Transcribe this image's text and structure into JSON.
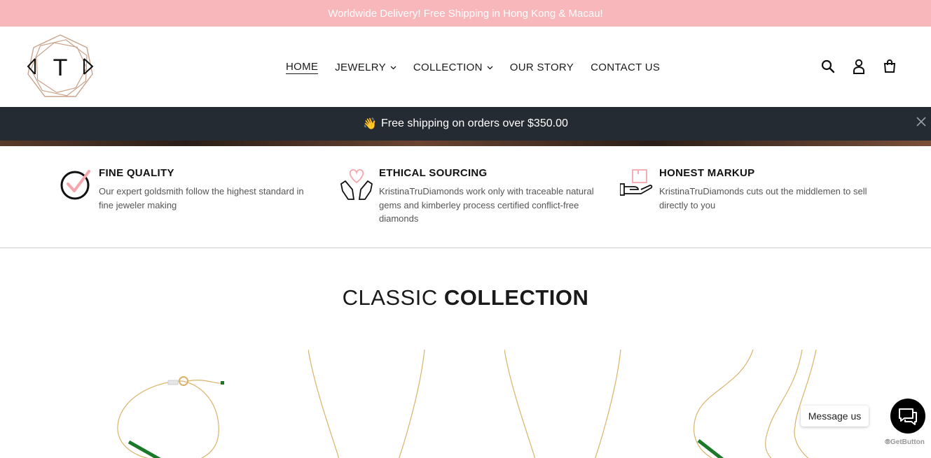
{
  "announcement": {
    "text": "Worldwide Delivery! Free Shipping in Hong Kong & Macau!"
  },
  "header": {
    "logo_letter": "T",
    "nav": [
      {
        "label": "HOME",
        "has_dropdown": false,
        "active": true
      },
      {
        "label": "JEWELRY",
        "has_dropdown": true,
        "active": false
      },
      {
        "label": "COLLECTION",
        "has_dropdown": true,
        "active": false
      },
      {
        "label": "OUR STORY",
        "has_dropdown": false,
        "active": false
      },
      {
        "label": "CONTACT US",
        "has_dropdown": false,
        "active": false
      }
    ],
    "icons": [
      "search-icon",
      "account-icon",
      "cart-icon"
    ]
  },
  "shipping_bar": {
    "emoji": "👋",
    "text": "Free shipping on orders over $350.00"
  },
  "features": [
    {
      "icon": "checkmark-circle-icon",
      "title": "FINE QUALITY",
      "text": "Our expert goldsmith follow the highest standard in fine jeweler making"
    },
    {
      "icon": "heart-hands-icon",
      "title": "ETHICAL SOURCING",
      "text": "KristinaTruDiamonds work only with traceable natural gems and kimberley process certified conflict-free diamonds"
    },
    {
      "icon": "box-hand-icon",
      "title": "HONEST MARKUP",
      "text": "KristinaTruDiamonds cuts out the middlemen to sell directly to you"
    }
  ],
  "collection": {
    "title_light": "CLASSIC",
    "title_bold": "COLLECTION"
  },
  "chat": {
    "bubble_text": "Message us",
    "brand": "GetButton"
  },
  "colors": {
    "announcement_bg": "#f8b7bb",
    "shipping_bar_bg": "#252b33",
    "accent_pink": "#f5a6ad",
    "logo_gold": "#c9a28a",
    "gem_green": "#1a7a2a",
    "gold_chain": "#d9b36a"
  }
}
